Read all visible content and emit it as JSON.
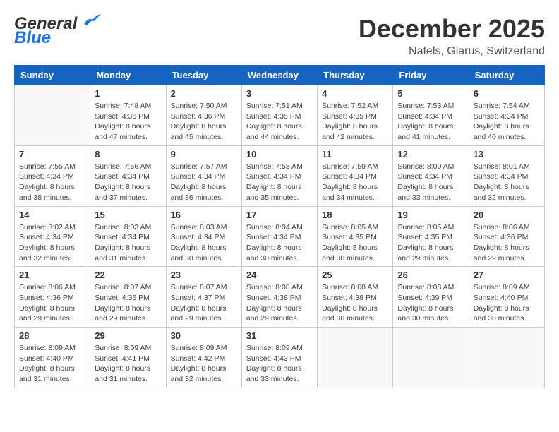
{
  "header": {
    "logo_general": "General",
    "logo_blue": "Blue",
    "month_title": "December 2025",
    "location": "Nafels, Glarus, Switzerland"
  },
  "days_of_week": [
    "Sunday",
    "Monday",
    "Tuesday",
    "Wednesday",
    "Thursday",
    "Friday",
    "Saturday"
  ],
  "weeks": [
    [
      {
        "day": "",
        "info": ""
      },
      {
        "day": "1",
        "info": "Sunrise: 7:48 AM\nSunset: 4:36 PM\nDaylight: 8 hours\nand 47 minutes."
      },
      {
        "day": "2",
        "info": "Sunrise: 7:50 AM\nSunset: 4:36 PM\nDaylight: 8 hours\nand 45 minutes."
      },
      {
        "day": "3",
        "info": "Sunrise: 7:51 AM\nSunset: 4:35 PM\nDaylight: 8 hours\nand 44 minutes."
      },
      {
        "day": "4",
        "info": "Sunrise: 7:52 AM\nSunset: 4:35 PM\nDaylight: 8 hours\nand 42 minutes."
      },
      {
        "day": "5",
        "info": "Sunrise: 7:53 AM\nSunset: 4:34 PM\nDaylight: 8 hours\nand 41 minutes."
      },
      {
        "day": "6",
        "info": "Sunrise: 7:54 AM\nSunset: 4:34 PM\nDaylight: 8 hours\nand 40 minutes."
      }
    ],
    [
      {
        "day": "7",
        "info": "Sunrise: 7:55 AM\nSunset: 4:34 PM\nDaylight: 8 hours\nand 38 minutes."
      },
      {
        "day": "8",
        "info": "Sunrise: 7:56 AM\nSunset: 4:34 PM\nDaylight: 8 hours\nand 37 minutes."
      },
      {
        "day": "9",
        "info": "Sunrise: 7:57 AM\nSunset: 4:34 PM\nDaylight: 8 hours\nand 36 minutes."
      },
      {
        "day": "10",
        "info": "Sunrise: 7:58 AM\nSunset: 4:34 PM\nDaylight: 8 hours\nand 35 minutes."
      },
      {
        "day": "11",
        "info": "Sunrise: 7:59 AM\nSunset: 4:34 PM\nDaylight: 8 hours\nand 34 minutes."
      },
      {
        "day": "12",
        "info": "Sunrise: 8:00 AM\nSunset: 4:34 PM\nDaylight: 8 hours\nand 33 minutes."
      },
      {
        "day": "13",
        "info": "Sunrise: 8:01 AM\nSunset: 4:34 PM\nDaylight: 8 hours\nand 32 minutes."
      }
    ],
    [
      {
        "day": "14",
        "info": "Sunrise: 8:02 AM\nSunset: 4:34 PM\nDaylight: 8 hours\nand 32 minutes."
      },
      {
        "day": "15",
        "info": "Sunrise: 8:03 AM\nSunset: 4:34 PM\nDaylight: 8 hours\nand 31 minutes."
      },
      {
        "day": "16",
        "info": "Sunrise: 8:03 AM\nSunset: 4:34 PM\nDaylight: 8 hours\nand 30 minutes."
      },
      {
        "day": "17",
        "info": "Sunrise: 8:04 AM\nSunset: 4:34 PM\nDaylight: 8 hours\nand 30 minutes."
      },
      {
        "day": "18",
        "info": "Sunrise: 8:05 AM\nSunset: 4:35 PM\nDaylight: 8 hours\nand 30 minutes."
      },
      {
        "day": "19",
        "info": "Sunrise: 8:05 AM\nSunset: 4:35 PM\nDaylight: 8 hours\nand 29 minutes."
      },
      {
        "day": "20",
        "info": "Sunrise: 8:06 AM\nSunset: 4:36 PM\nDaylight: 8 hours\nand 29 minutes."
      }
    ],
    [
      {
        "day": "21",
        "info": "Sunrise: 8:06 AM\nSunset: 4:36 PM\nDaylight: 8 hours\nand 29 minutes."
      },
      {
        "day": "22",
        "info": "Sunrise: 8:07 AM\nSunset: 4:36 PM\nDaylight: 8 hours\nand 29 minutes."
      },
      {
        "day": "23",
        "info": "Sunrise: 8:07 AM\nSunset: 4:37 PM\nDaylight: 8 hours\nand 29 minutes."
      },
      {
        "day": "24",
        "info": "Sunrise: 8:08 AM\nSunset: 4:38 PM\nDaylight: 8 hours\nand 29 minutes."
      },
      {
        "day": "25",
        "info": "Sunrise: 8:08 AM\nSunset: 4:38 PM\nDaylight: 8 hours\nand 30 minutes."
      },
      {
        "day": "26",
        "info": "Sunrise: 8:08 AM\nSunset: 4:39 PM\nDaylight: 8 hours\nand 30 minutes."
      },
      {
        "day": "27",
        "info": "Sunrise: 8:09 AM\nSunset: 4:40 PM\nDaylight: 8 hours\nand 30 minutes."
      }
    ],
    [
      {
        "day": "28",
        "info": "Sunrise: 8:09 AM\nSunset: 4:40 PM\nDaylight: 8 hours\nand 31 minutes."
      },
      {
        "day": "29",
        "info": "Sunrise: 8:09 AM\nSunset: 4:41 PM\nDaylight: 8 hours\nand 31 minutes."
      },
      {
        "day": "30",
        "info": "Sunrise: 8:09 AM\nSunset: 4:42 PM\nDaylight: 8 hours\nand 32 minutes."
      },
      {
        "day": "31",
        "info": "Sunrise: 8:09 AM\nSunset: 4:43 PM\nDaylight: 8 hours\nand 33 minutes."
      },
      {
        "day": "",
        "info": ""
      },
      {
        "day": "",
        "info": ""
      },
      {
        "day": "",
        "info": ""
      }
    ]
  ]
}
